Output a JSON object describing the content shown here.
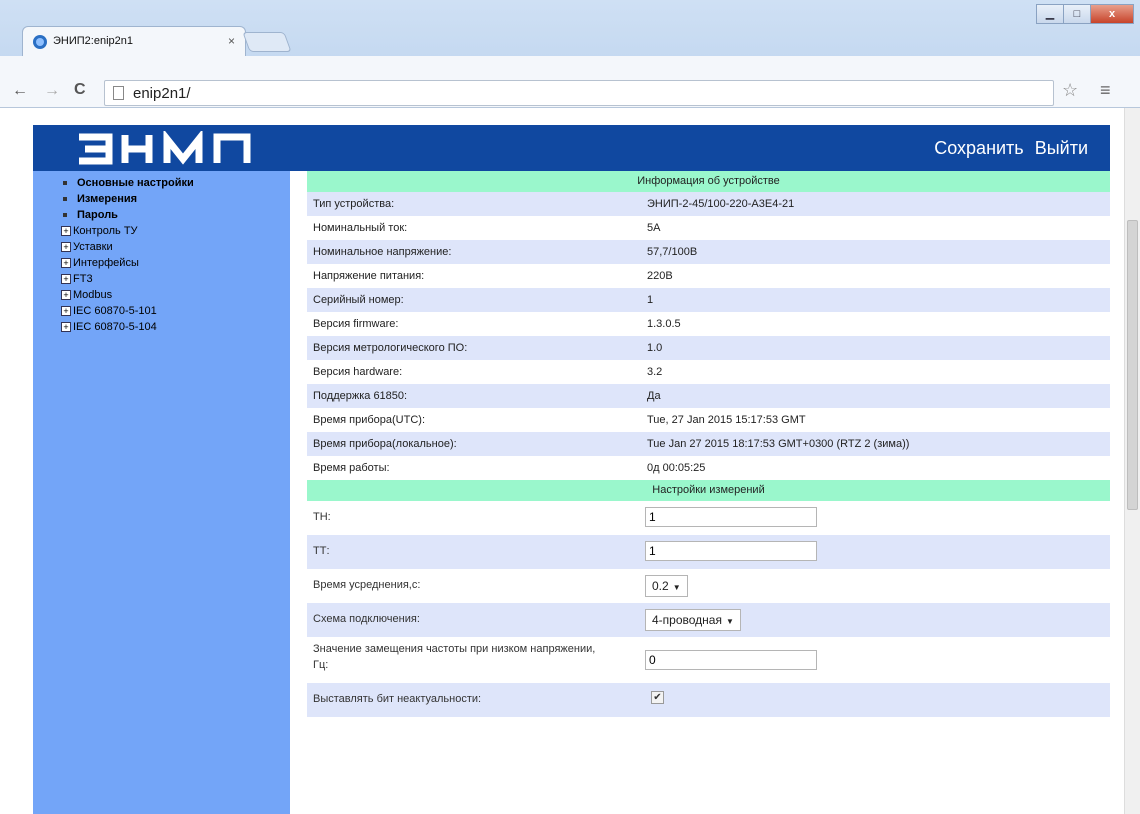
{
  "browser": {
    "tab_title": "ЭНИП2:enip2n1",
    "tab_close": "×",
    "url": "enip2n1/",
    "win_min": "▁",
    "win_max": "□",
    "win_close": "x"
  },
  "header": {
    "logo_text": "ЭНИП",
    "save_label": "Сохранить",
    "logout_label": "Выйти",
    "bg_color": "#1048a0"
  },
  "sidebar": {
    "bg_color": "#73a5f8",
    "items": [
      {
        "label": "Основные настройки",
        "kind": "bullet"
      },
      {
        "label": "Измерения",
        "kind": "bullet"
      },
      {
        "label": "Пароль",
        "kind": "bullet"
      },
      {
        "label": "Контроль ТУ",
        "kind": "expand"
      },
      {
        "label": "Уставки",
        "kind": "expand"
      },
      {
        "label": "Интерфейсы",
        "kind": "expand"
      },
      {
        "label": "FT3",
        "kind": "expand"
      },
      {
        "label": "Modbus",
        "kind": "expand"
      },
      {
        "label": "IEC 60870-5-101",
        "kind": "expand"
      },
      {
        "label": "IEC 60870-5-104",
        "kind": "expand"
      }
    ]
  },
  "device_info": {
    "title": "Информация об устройстве",
    "rows": [
      {
        "key": "Тип устройства:",
        "value": "ЭНИП-2-45/100-220-А3Е4-21"
      },
      {
        "key": "Номинальный ток:",
        "value": "5А"
      },
      {
        "key": "Номинальное напряжение:",
        "value": "57,7/100В"
      },
      {
        "key": "Напряжение питания:",
        "value": "220В"
      },
      {
        "key": "Серийный номер:",
        "value": "1"
      },
      {
        "key": "Версия firmware:",
        "value": "1.3.0.5"
      },
      {
        "key": "Версия метрологического ПО:",
        "value": "1.0"
      },
      {
        "key": "Версия hardware:",
        "value": "3.2"
      },
      {
        "key": "Поддержка 61850:",
        "value": "Да"
      },
      {
        "key": "Время прибора(UTC):",
        "value": "Tue, 27 Jan 2015 15:17:53 GMT"
      },
      {
        "key": "Время прибора(локальное):",
        "value": "Tue Jan 27 2015 18:17:53 GMT+0300 (RTZ 2 (зима))"
      },
      {
        "key": "Время работы:",
        "value": "0д 00:05:25"
      }
    ]
  },
  "measure_settings": {
    "title": "Настройки измерений",
    "th_label": "ТН:",
    "th_value": "1",
    "tt_label": "ТТ:",
    "tt_value": "1",
    "avg_label": "Время усреднения,с:",
    "avg_value": "0.2",
    "scheme_label": "Схема подключения:",
    "scheme_value": "4-проводная",
    "freq_label": "Значение замещения частоты при низком напряжении, Гц:",
    "freq_value": "0",
    "bit_label": "Выставлять бит неактуальности:",
    "bit_checked": "✔"
  },
  "colors": {
    "section_head": "#9af7cc",
    "row_alt": "#dee5fa"
  }
}
